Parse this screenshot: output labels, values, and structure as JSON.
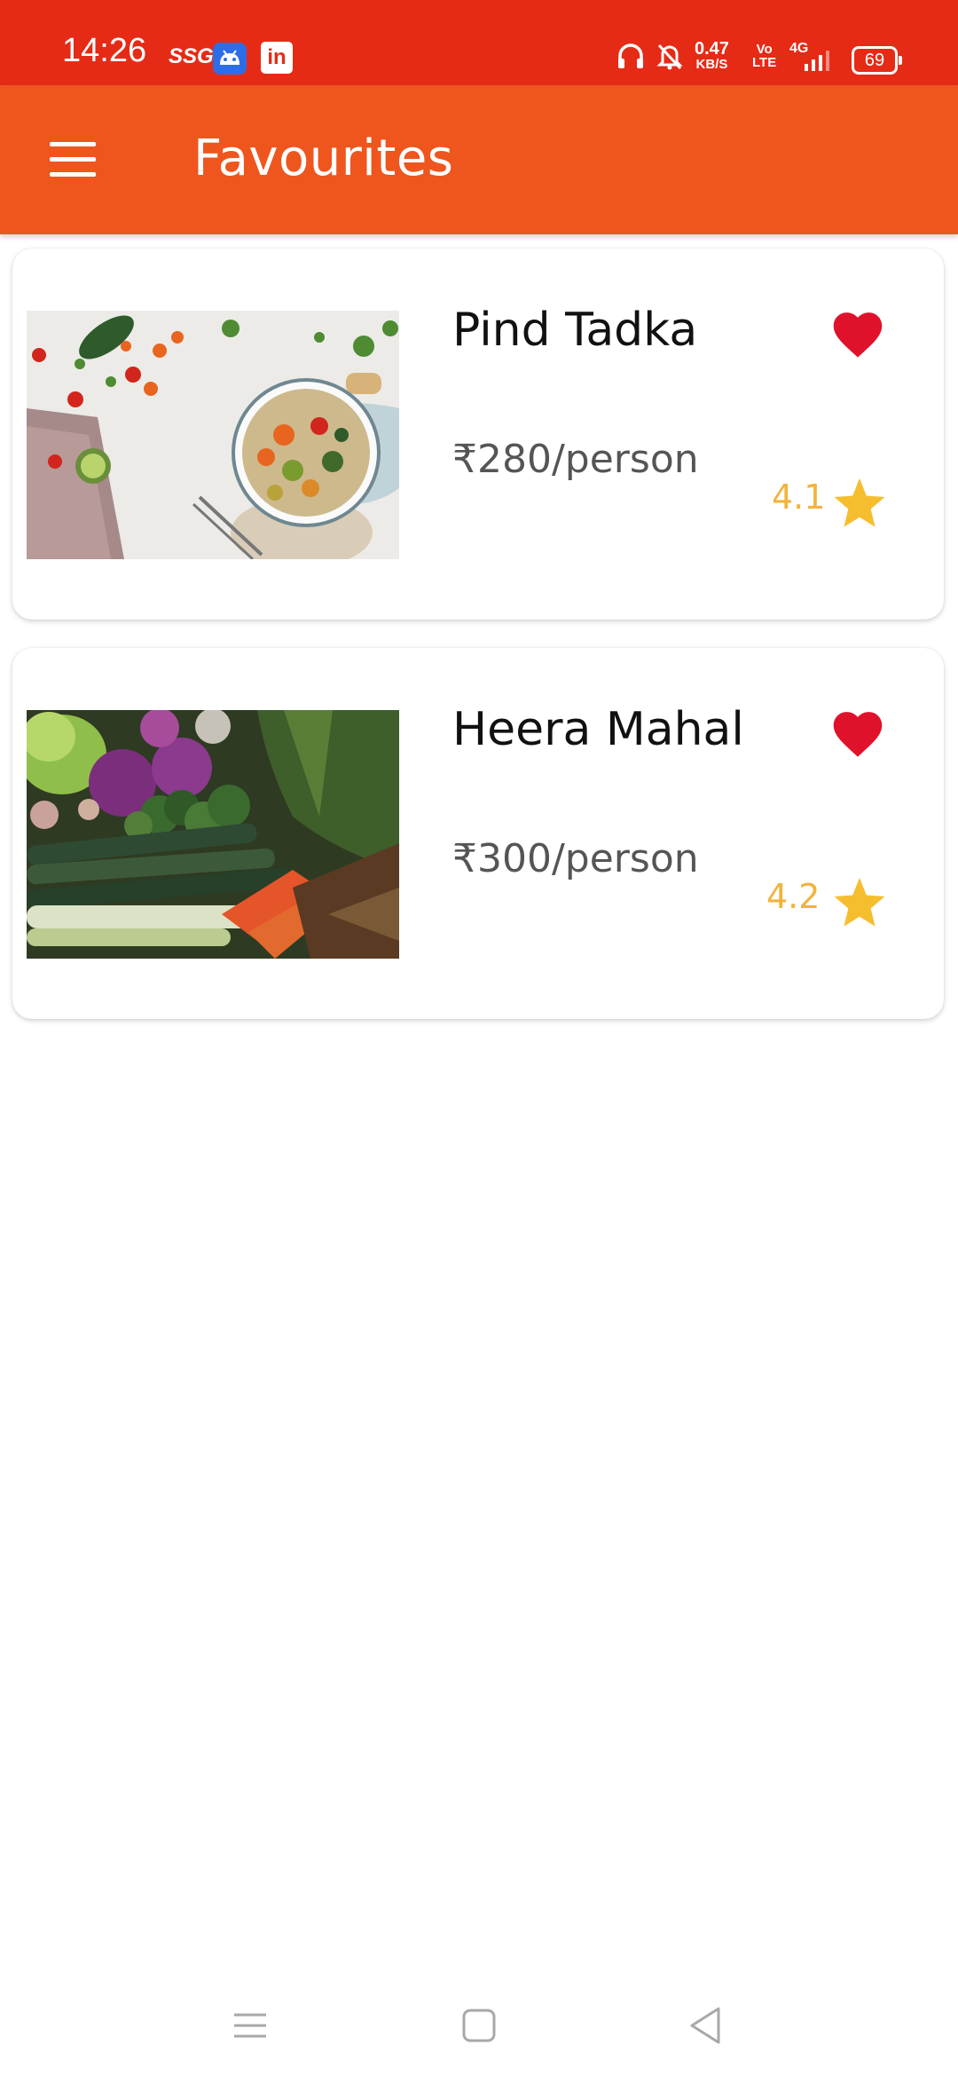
{
  "status_bar": {
    "time": "14:26",
    "ssg": "SSG",
    "linkedin": "in",
    "speed_value": "0.47",
    "speed_unit": "KB/S",
    "volte_top": "Vo",
    "volte_bottom": "LTE",
    "network": "4G",
    "battery": "69"
  },
  "app_bar": {
    "title": "Favourites",
    "background": "#EE561E"
  },
  "restaurants": [
    {
      "name": "Pind Tadka",
      "price": "₹280/person",
      "rating": "4.1",
      "favourite": true,
      "image": "food-bowl-photo"
    },
    {
      "name": "Heera Mahal",
      "price": "₹300/person",
      "rating": "4.2",
      "favourite": true,
      "image": "vegetables-photo"
    }
  ],
  "colors": {
    "status_bar": "#E52B16",
    "heart": "#E0122B",
    "star": "#F5BE2E",
    "rating_text": "#F2B33D"
  },
  "nav": [
    "menu-icon",
    "home-icon",
    "back-icon"
  ]
}
